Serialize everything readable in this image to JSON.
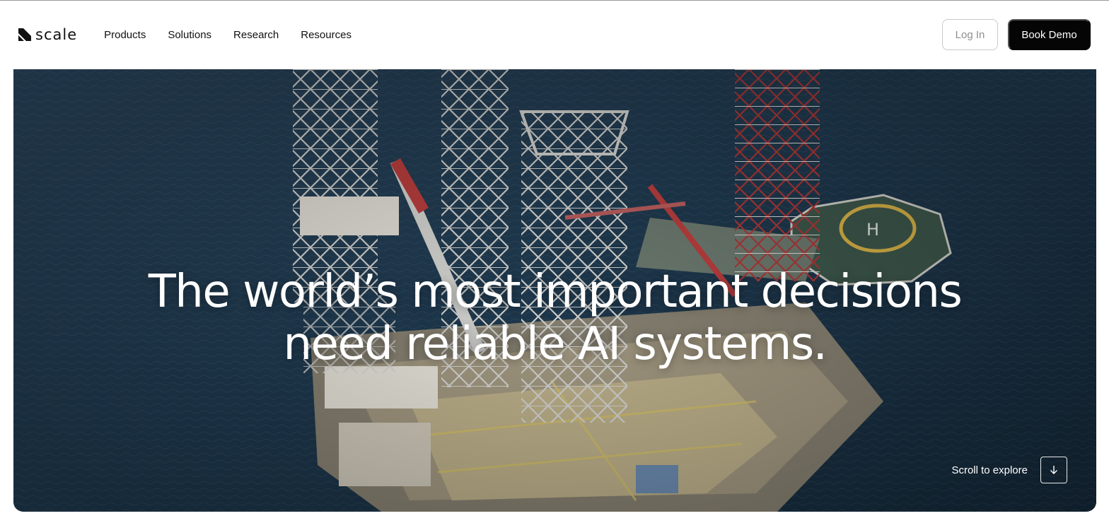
{
  "brand": {
    "name": "scale",
    "logo_icon": "scale-logo-mark"
  },
  "nav": {
    "items": [
      {
        "label": "Products"
      },
      {
        "label": "Solutions"
      },
      {
        "label": "Research"
      },
      {
        "label": "Resources"
      }
    ]
  },
  "actions": {
    "login_label": "Log In",
    "demo_label": "Book Demo"
  },
  "hero": {
    "headline_line1": "The world’s most important decisions",
    "headline_line2": "need reliable AI systems.",
    "scroll_label": "Scroll to explore",
    "scroll_icon": "arrow-down-icon"
  },
  "colors": {
    "primary_button": "#050505",
    "hero_ocean": "#1c3346",
    "text_light": "#ffffff"
  }
}
